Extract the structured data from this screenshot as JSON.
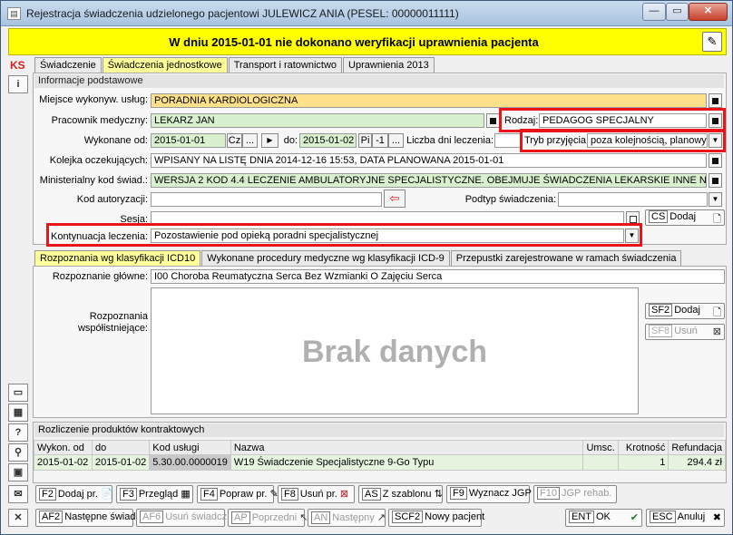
{
  "window": {
    "title": "Rejestracja świadczenia udzielonego pacjentowi JULEWICZ ANIA (PESEL: 00000011111)",
    "min": "—",
    "max": "▭",
    "close": "✕"
  },
  "banner": {
    "text": "W dniu 2015-01-01 nie dokonano weryfikacji uprawnienia pacjenta"
  },
  "sidebar": {
    "logo": "KS",
    "info": "i",
    "help": "?"
  },
  "tabs_top": [
    "Świadczenie",
    "Świadczenia jednostkowe",
    "Transport i ratownictwo",
    "Uprawnienia 2013"
  ],
  "section": {
    "title": "Informacje podstawowe"
  },
  "form": {
    "miejsce_label": "Miejsce wykonyw. usług:",
    "miejsce_value": "PORADNIA KARDIOLOGICZNA",
    "pracownik_label": "Pracownik medyczny:",
    "pracownik_value": "LEKARZ JAN",
    "rodzaj_label": "Rodzaj:",
    "rodzaj_value": "PEDAGOG SPECJALNY",
    "wykonane_od_label": "Wykonane od:",
    "wykonane_od_value": "2015-01-01",
    "cz_label": "Cz",
    "ellipsis": "...",
    "do_label": "do:",
    "do_value": "2015-01-02",
    "pi_label": "Pi",
    "pi_value": "-1",
    "liczba_dni_label": "Liczba dni leczenia:",
    "tryb_label": "Tryb przyjęcia:",
    "tryb_value": "poza kolejnością, planowy",
    "kolejka_label": "Kolejka oczekujących:",
    "kolejka_value": "WPISANY NA LISTĘ DNIA 2014-12-16 15:53, DATA PLANOWANA 2015-01-01",
    "ministerialny_label": "Ministerialny kod świad.:",
    "ministerialny_value": "WERSJA 2 KOD 4.4 LECZENIE AMBULATORYJNE SPECJALISTYCZNE. OBEJMUJE  ŚWIADCZENIA LEKARSKIE INNE NIŻ",
    "kod_autoryzacji_label": "Kod autoryzacji:",
    "podtyp_label": "Podtyp świadczenia:",
    "sesja_label": "Sesja:",
    "cs_key": "CS",
    "cs_label": "Dodaj",
    "kontynuacja_label": "Kontynuacja leczenia:",
    "kontynuacja_value": "Pozostawienie pod opieką poradni specjalistycznej"
  },
  "tabs_diag": [
    "Rozpoznania wg klasyfikacji ICD10",
    "Wykonane procedury medyczne wg klasyfikacji ICD-9",
    "Przepustki zarejestrowane w ramach świadczenia"
  ],
  "diag": {
    "glowne_label": "Rozpoznanie główne:",
    "glowne_value": "I00 Choroba Reumatyczna Serca Bez Wzmianki O Zajęciu Serca",
    "wspol_label_1": "Rozpoznania",
    "wspol_label_2": "współistniejące:",
    "no_data": "Brak danych",
    "sf2_key": "SF2",
    "sf2_label": "Dodaj",
    "sf8_key": "SF8",
    "sf8_label": "Usuń"
  },
  "rozliczenie": {
    "title": "Rozliczenie produktów kontraktowych",
    "columns": [
      "Wykon. od",
      "do",
      "Kod usługi",
      "Nazwa",
      "Umsc.",
      "Krotność",
      "Refundacja"
    ],
    "rows": [
      [
        "2015-01-02",
        "2015-01-02",
        "5.30.00.0000019",
        "W19 Świadczenie Specjalistyczne 9-Go Typu",
        "",
        "1",
        "294.4 zł"
      ]
    ]
  },
  "toolbar1": [
    {
      "key": "F2",
      "label": "Dodaj pr.",
      "icon": "📄",
      "disabled": false
    },
    {
      "key": "F3",
      "label": "Przegląd",
      "icon": "▦",
      "disabled": false
    },
    {
      "key": "F4",
      "label": "Popraw pr.",
      "icon": "✎",
      "disabled": false
    },
    {
      "key": "F8",
      "label": "Usuń pr.",
      "icon": "⊠",
      "disabled": false
    },
    {
      "key": "AS",
      "label": "Z szablonu",
      "icon": "⇅",
      "disabled": false
    },
    {
      "key": "F9",
      "label": "Wyznacz JGP",
      "icon": "",
      "disabled": false
    },
    {
      "key": "F10",
      "label": "JGP rehab.",
      "icon": "",
      "disabled": true
    }
  ],
  "toolbar2": [
    {
      "key": "AF2",
      "label": "Następne świad.",
      "icon": "",
      "disabled": false
    },
    {
      "key": "AF6",
      "label": "Usuń świadcz.",
      "icon": "",
      "disabled": true
    },
    {
      "key": "AP",
      "label": "Poprzedni",
      "icon": "↖",
      "disabled": true
    },
    {
      "key": "AN",
      "label": "Następny",
      "icon": "↗",
      "disabled": true
    },
    {
      "key": "SCF2",
      "label": "Nowy pacjent",
      "icon": "",
      "disabled": false
    },
    {
      "key": "ENT",
      "label": "OK",
      "icon": "✔",
      "disabled": false
    },
    {
      "key": "ESC",
      "label": "Anuluj",
      "icon": "✖",
      "disabled": false
    }
  ]
}
